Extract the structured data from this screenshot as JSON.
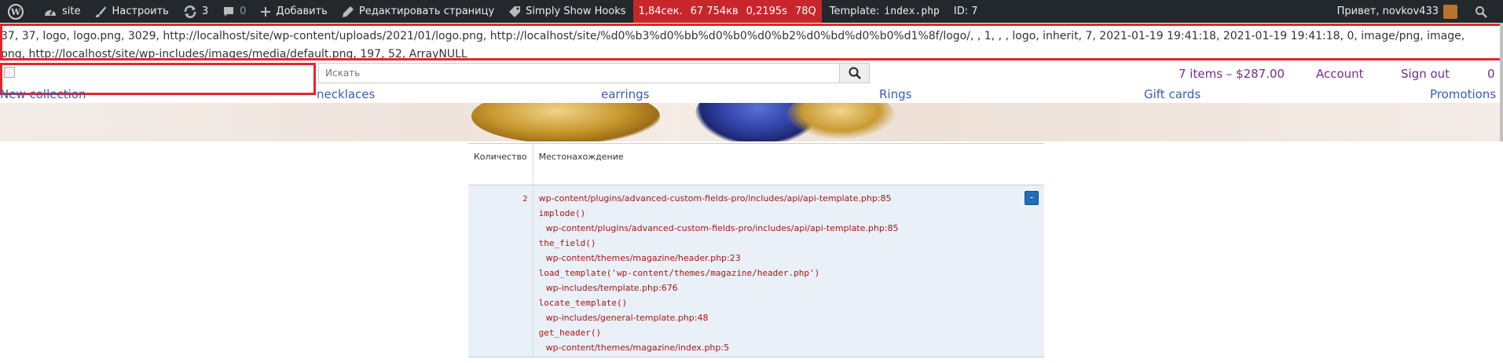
{
  "adminbar": {
    "site_label": "site",
    "customize_label": "Настроить",
    "updates_count": "3",
    "comments_count": "0",
    "add_label": "Добавить",
    "edit_page_label": "Редактировать страницу",
    "show_hooks_label": "Simply Show Hooks",
    "qm": {
      "time": "1,84сек.",
      "memory": "67 754кв",
      "db_time": "0,2195s",
      "queries": "78Q"
    },
    "template_label": "Template:",
    "template_file": "index.php",
    "id_label": "ID: 7",
    "greeting": "Привет, novkov433",
    "colors": {
      "bar_bg": "#23282d",
      "qm_bg": "#c9262c"
    }
  },
  "debug": {
    "line1": "37, 37, logo, logo.png, 3029, http://localhost/site/wp-content/uploads/2021/01/logo.png, http://localhost/site/%d0%b3%d0%bb%d0%b0%d0%b2%d0%bd%d0%b0%d1%8f/logo/, , 1, , , logo, inherit, 7, 2021-01-19 19:41:18, 2021-01-19 19:41:18, 0, image/png, image,",
    "line2": "png, http://localhost/site/wp-includes/images/media/default.png, 197, 52, ArrayNULL"
  },
  "header": {
    "search_placeholder": "Искать",
    "cart": "7 items – $287.00",
    "account": "Account",
    "signout": "Sign out",
    "extra": "0"
  },
  "nav": [
    "New collection",
    "necklaces",
    "earrings",
    "Rings",
    "Gift cards",
    "Promotions"
  ],
  "qm_table": {
    "col_count": "Количество",
    "col_location": "Местонахождение",
    "count": "2",
    "toggle_label": "-",
    "trace": [
      {
        "type": "path",
        "text": "wp-content/plugins/advanced-custom-fields-pro/includes/api/api-template.php:85"
      },
      {
        "type": "fn",
        "text": "implode()"
      },
      {
        "type": "path",
        "text": "wp-content/plugins/advanced-custom-fields-pro/includes/api/api-template.php:85"
      },
      {
        "type": "fn",
        "text": "the_field()"
      },
      {
        "type": "path",
        "text": "wp-content/themes/magazine/header.php:23"
      },
      {
        "type": "fn",
        "text": "load_template('wp-content/themes/magazine/header.php')"
      },
      {
        "type": "path",
        "text": "wp-includes/template.php:676"
      },
      {
        "type": "fn",
        "text": "locate_template()"
      },
      {
        "type": "path",
        "text": "wp-includes/general-template.php:48"
      },
      {
        "type": "fn",
        "text": "get_header()"
      },
      {
        "type": "path",
        "text": "wp-content/themes/magazine/index.php:5"
      }
    ]
  }
}
